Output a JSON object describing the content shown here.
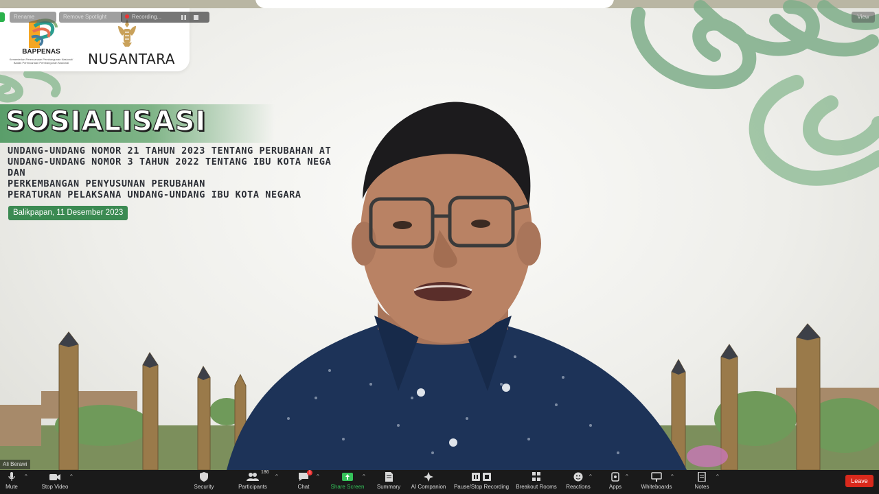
{
  "slide": {
    "org_name": "BAPPENAS",
    "org_subtitle_1": "Kementerian Perencanaan Pembangunan Nasional/",
    "org_subtitle_2": "Badan Perencanaan Pembangunan Nasional",
    "brand": "NUSANTARA",
    "title": "SOSIALISASI",
    "subtitle_lines": [
      "UNDANG-UNDANG NOMOR 21 TAHUN 2023 TENTANG PERUBAHAN AT",
      "UNDANG-UNDANG NOMOR 3 TAHUN 2022 TENTANG IBU KOTA NEGA",
      "DAN",
      "PERKEMBANGAN PENYUSUNAN PERUBAHAN",
      "PERATURAN PELAKSANA UNDANG-UNDANG IBU KOTA NEGARA"
    ],
    "date": "Balikpapan, 11 Desember 2023",
    "accent_color": "#3b8a52"
  },
  "video": {
    "participant_name": "Ali Berawi"
  },
  "top_controls": {
    "rename_label": "Rename",
    "spotlight_label": "Remove Spotlight",
    "recording_label": "Recording...",
    "view_label": "View"
  },
  "toolbar": {
    "mute": "Mute",
    "stop_video": "Stop Video",
    "security": "Security",
    "participants": "Participants",
    "participants_count": "186",
    "chat": "Chat",
    "chat_badge": "1",
    "share_screen": "Share Screen",
    "summary": "Summary",
    "ai_companion": "AI Companion",
    "pause_stop_recording": "Pause/Stop Recording",
    "breakout_rooms": "Breakout Rooms",
    "reactions": "Reactions",
    "apps": "Apps",
    "whiteboards": "Whiteboards",
    "notes": "Notes",
    "leave": "Leave",
    "leave_color": "#d9291c",
    "share_color": "#35c25a"
  }
}
